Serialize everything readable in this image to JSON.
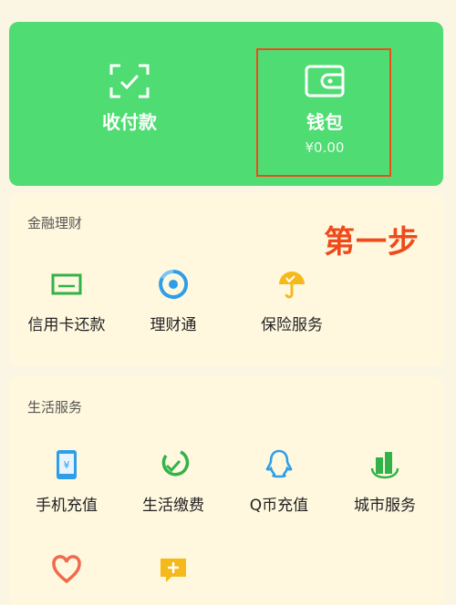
{
  "hero": {
    "receive_pay": {
      "label": "收付款",
      "icon": "scan-qr-icon"
    },
    "wallet": {
      "label": "钱包",
      "balance": "¥0.00",
      "icon": "wallet-icon"
    }
  },
  "annotation": {
    "text": "第一步",
    "color": "#f04a1b"
  },
  "finance": {
    "title": "金融理财",
    "items": [
      {
        "label": "信用卡还款",
        "icon": "credit-card-icon"
      },
      {
        "label": "理财通",
        "icon": "wealth-circle-icon"
      },
      {
        "label": "保险服务",
        "icon": "umbrella-icon"
      }
    ]
  },
  "life": {
    "title": "生活服务",
    "items": [
      {
        "label": "手机充值",
        "icon": "phone-icon"
      },
      {
        "label": "生活缴费",
        "icon": "leaf-check-icon"
      },
      {
        "label": "Q币充值",
        "icon": "qq-penguin-icon"
      },
      {
        "label": "城市服务",
        "icon": "city-buildings-icon"
      }
    ],
    "more_icons": [
      "heart-hands-icon",
      "chat-plus-icon"
    ]
  },
  "colors": {
    "green": "#4fdc72",
    "accent_red": "#f04a1b",
    "bg": "#fbf6e3"
  }
}
